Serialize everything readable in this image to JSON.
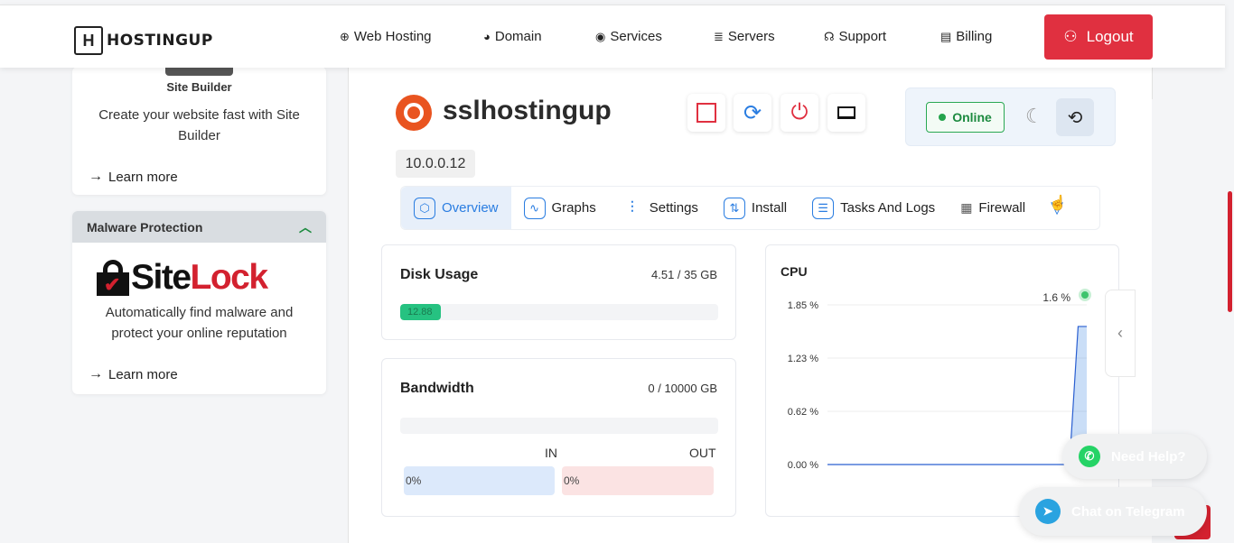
{
  "brand": {
    "name": "HOSTINGUP"
  },
  "nav": {
    "items": [
      {
        "label": "Web Hosting",
        "icon": "globe-icon"
      },
      {
        "label": "Domain",
        "icon": "world-icon"
      },
      {
        "label": "Services",
        "icon": "compass-icon"
      },
      {
        "label": "Servers",
        "icon": "database-icon"
      },
      {
        "label": "Support",
        "icon": "headset-icon"
      },
      {
        "label": "Billing",
        "icon": "receipt-icon"
      }
    ],
    "logout_label": "Logout"
  },
  "sidebar": {
    "site_builder": {
      "title": "Site Builder",
      "description": "Create your website fast with Site Builder",
      "learn_more": "Learn more"
    },
    "malware": {
      "header": "Malware Protection",
      "brand_site": "Site",
      "brand_lock": "Lock",
      "description": "Automatically find malware and protect your online reputation",
      "learn_more": "Learn more"
    }
  },
  "server": {
    "name": "sslhostingup",
    "ip": "10.0.0.12",
    "status": "Online",
    "os_icon": "ubuntu-icon"
  },
  "tabs": [
    {
      "label": "Overview",
      "active": true
    },
    {
      "label": "Graphs"
    },
    {
      "label": "Settings"
    },
    {
      "label": "Install"
    },
    {
      "label": "Tasks And Logs"
    },
    {
      "label": "Firewall"
    }
  ],
  "disk": {
    "title": "Disk Usage",
    "value": "4.51 / 35 GB",
    "percent_label": "12.88",
    "percent": 12.88
  },
  "bandwidth": {
    "title": "Bandwidth",
    "value": "0 / 10000 GB",
    "in_label": "IN",
    "out_label": "OUT",
    "in_value": "0%",
    "out_value": "0%"
  },
  "chart_data": {
    "type": "area",
    "title": "CPU",
    "ylim": [
      0,
      1.85
    ],
    "y_ticks": [
      "1.85 %",
      "1.23 %",
      "0.62 %",
      "0.00 %"
    ],
    "current_label": "1.6 %",
    "series": [
      {
        "values": [
          0,
          0,
          0,
          0,
          0,
          0,
          0,
          0,
          0,
          0,
          0,
          0,
          0,
          0,
          0,
          0,
          0,
          0,
          0,
          0,
          0,
          0,
          0,
          0,
          0,
          0,
          0,
          0,
          0,
          1.6,
          1.6
        ]
      }
    ],
    "grid": true
  },
  "floating": {
    "whatsapp": "Need Help?",
    "telegram": "Chat on Telegram"
  },
  "colors": {
    "accent_blue": "#2a7de1",
    "danger_red": "#e03040",
    "online_green": "#23a34b"
  }
}
